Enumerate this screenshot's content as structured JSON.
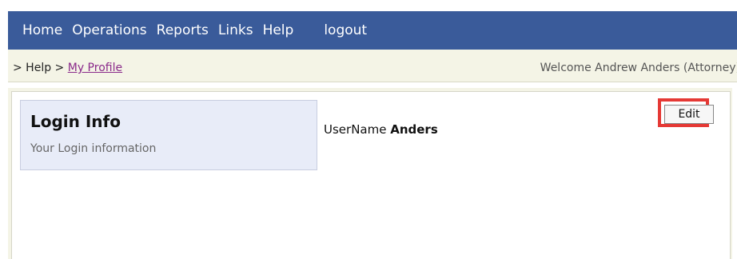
{
  "nav": {
    "items": [
      "Home",
      "Operations",
      "Reports",
      "Links",
      "Help"
    ],
    "logout": "logout"
  },
  "breadcrumb": {
    "prefix": "> Help >",
    "current": "My Profile"
  },
  "welcome_text": "Welcome Andrew Anders (Attorney)",
  "login_info": {
    "title": "Login Info",
    "subtitle": "Your Login information"
  },
  "username": {
    "label": "UserName",
    "value": "Anders"
  },
  "edit_label": "Edit",
  "colors": {
    "nav_bg": "#3a5b9a",
    "panel_bg": "#e8ecf8",
    "highlight": "#e53935"
  }
}
